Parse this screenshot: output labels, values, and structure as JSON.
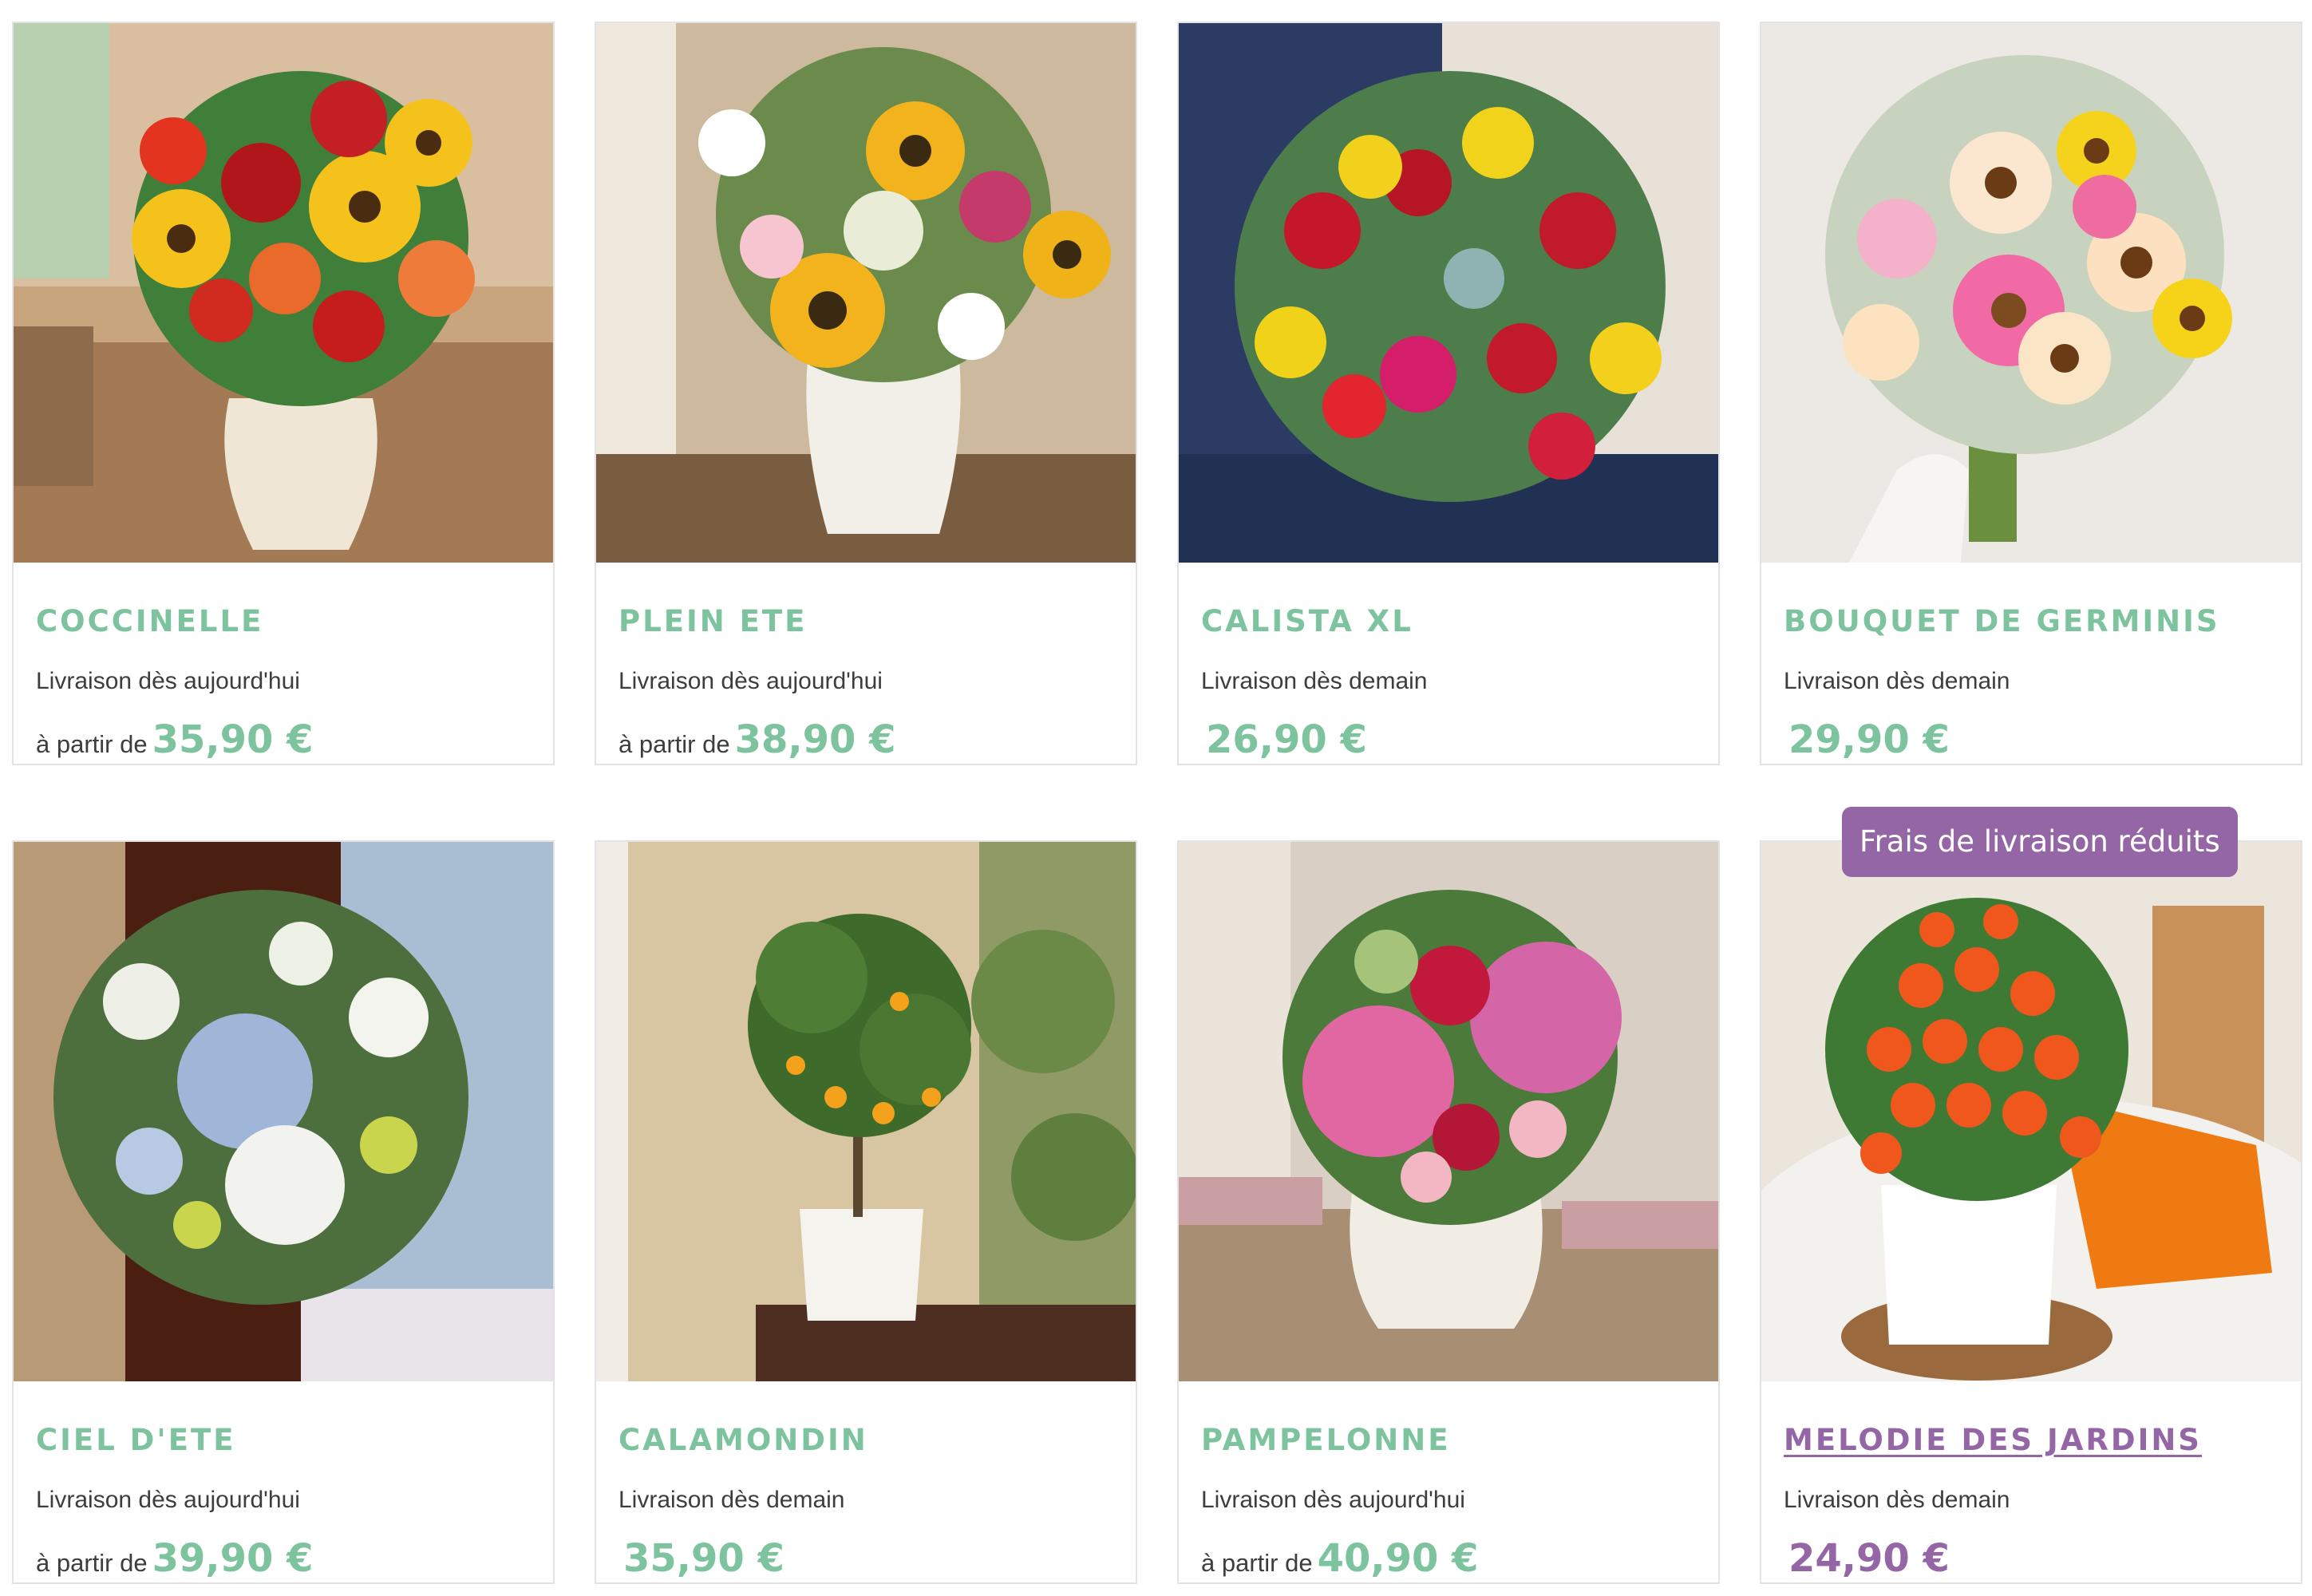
{
  "products": [
    {
      "name": "COCCINELLE",
      "delivery": "Livraison dès aujourd'hui",
      "from": "à partir de",
      "price": "35,90 €"
    },
    {
      "name": "PLEIN ETE",
      "delivery": "Livraison dès aujourd'hui",
      "from": "à partir de",
      "price": "38,90 €"
    },
    {
      "name": "CALISTA XL",
      "delivery": "Livraison dès demain",
      "from": "",
      "price": "26,90 €"
    },
    {
      "name": "BOUQUET DE GERMINIS",
      "delivery": "Livraison dès demain",
      "from": "",
      "price": "29,90 €"
    },
    {
      "name": "CIEL D'ETE",
      "delivery": "Livraison dès aujourd'hui",
      "from": "à partir de",
      "price": "39,90 €"
    },
    {
      "name": "CALAMONDIN",
      "delivery": "Livraison dès demain",
      "from": "",
      "price": "35,90 €"
    },
    {
      "name": "PAMPELONNE",
      "delivery": "Livraison dès aujourd'hui",
      "from": "à partir de",
      "price": "40,90 €"
    },
    {
      "name": "MELODIE DES JARDINS",
      "delivery": "Livraison dès demain",
      "from": "",
      "price": "24,90 €",
      "badge": "Frais de livraison réduits"
    }
  ],
  "colors": {
    "accent_green": "#7cc39e",
    "accent_purple": "#9466a6",
    "border": "#e3e3e3",
    "text": "#3d3d3d"
  },
  "icons": [
    "bouquet-photo",
    "citrus-tree-photo"
  ]
}
